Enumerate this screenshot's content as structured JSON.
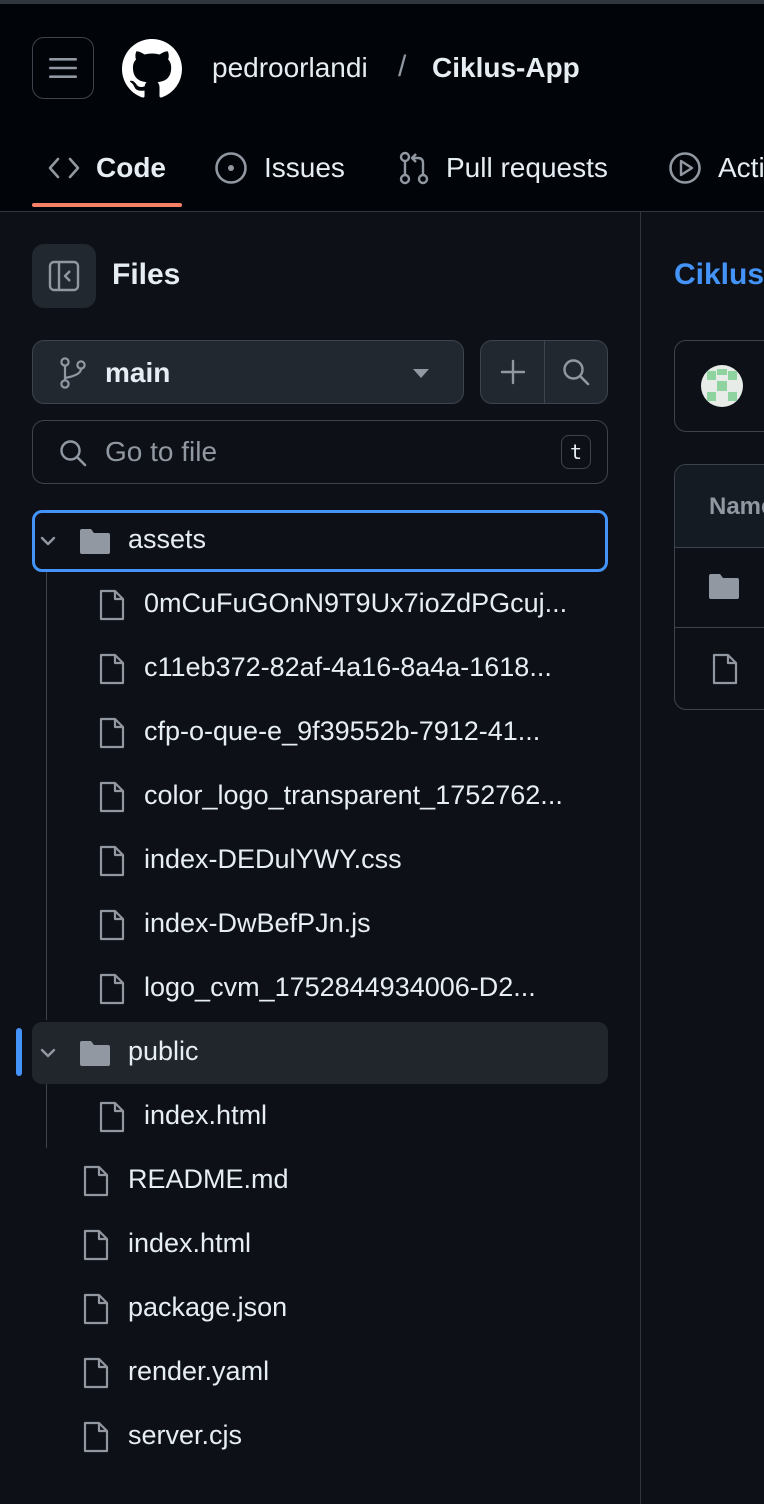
{
  "header": {
    "owner": "pedroorlandi",
    "separator": "/",
    "repo": "Ciklus-App",
    "tabs": [
      {
        "label": "Code",
        "icon": "code-icon"
      },
      {
        "label": "Issues",
        "icon": "issue-opened-icon"
      },
      {
        "label": "Pull requests",
        "icon": "git-pull-request-icon"
      },
      {
        "label": "Actions",
        "icon": "play-icon"
      }
    ]
  },
  "sidebar": {
    "title": "Files",
    "branch": "main",
    "search_placeholder": "Go to file",
    "shortcut_key": "t",
    "tree": [
      {
        "name": "assets",
        "type": "folder",
        "expanded": true
      },
      {
        "name": "0mCuFuGOnN9T9Ux7ioZdPGcuj...",
        "type": "file"
      },
      {
        "name": "c11eb372-82af-4a16-8a4a-1618...",
        "type": "file"
      },
      {
        "name": "cfp-o-que-e_9f39552b-7912-41...",
        "type": "file"
      },
      {
        "name": "color_logo_transparent_1752762...",
        "type": "file"
      },
      {
        "name": "index-DEDulYWY.css",
        "type": "file"
      },
      {
        "name": "index-DwBefPJn.js",
        "type": "file"
      },
      {
        "name": "logo_cvm_1752844934006-D2...",
        "type": "file"
      },
      {
        "name": "public",
        "type": "folder",
        "expanded": true
      },
      {
        "name": "index.html",
        "type": "file"
      },
      {
        "name": "README.md",
        "type": "file"
      },
      {
        "name": "index.html",
        "type": "file"
      },
      {
        "name": "package.json",
        "type": "file"
      },
      {
        "name": "render.yaml",
        "type": "file"
      },
      {
        "name": "server.cjs",
        "type": "file"
      }
    ]
  },
  "main": {
    "repo_title": "Ciklus",
    "table_header": "Name"
  },
  "colors": {
    "background": "#0d1117",
    "header_bg": "#010409",
    "accent_link": "#4493f8",
    "tab_underline": "#f78166",
    "border": "#3d444d"
  }
}
